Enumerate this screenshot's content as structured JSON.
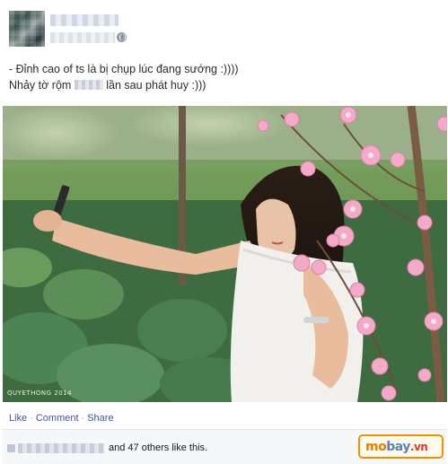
{
  "post": {
    "line1": "- Đỉnh cao of ts là bị chụp lúc đang sướng :))))",
    "line2_before": "Nhảy tờ rộm ",
    "line2_after": " lần sau phát huy :)))"
  },
  "photo": {
    "watermark": "QUYETHONG 2014"
  },
  "actions": {
    "like": "Like",
    "comment": "Comment",
    "share": "Share",
    "separator": "·"
  },
  "likes": {
    "summary": "and 47 others like this."
  },
  "logo": {
    "part1": "mo",
    "part2": "bay",
    "part3": ".vn"
  },
  "colors": {
    "link": "#3b5998",
    "likes_bar": "#f6f7f9",
    "blossom": "#f3a9c8",
    "logo_orange": "#ea7d00"
  },
  "icons": [
    "avatar",
    "globe-icon",
    "like-icon"
  ]
}
